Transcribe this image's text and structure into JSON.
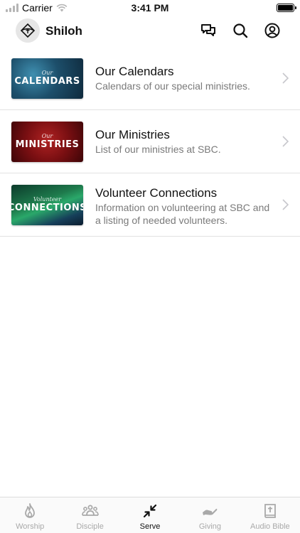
{
  "status_bar": {
    "carrier": "Carrier",
    "time": "3:41 PM"
  },
  "header": {
    "app_name": "Shiloh",
    "icons": [
      "chat-icon",
      "search-icon",
      "profile-icon"
    ]
  },
  "items": [
    {
      "title": "Our Calendars",
      "subtitle": "Calendars of our special ministries.",
      "thumb_script": "Our",
      "thumb_title": "CALENDARS"
    },
    {
      "title": "Our Ministries",
      "subtitle": "List of our ministries at SBC.",
      "thumb_script": "Our",
      "thumb_title": "MINISTRIES"
    },
    {
      "title": "Volunteer Connections",
      "subtitle": "Information on volunteering at SBC and a listing of needed volunteers.",
      "thumb_script": "Volunteer",
      "thumb_title": "CONNECTIONS"
    }
  ],
  "tabs": [
    {
      "label": "Worship",
      "icon": "flame-icon",
      "active": false
    },
    {
      "label": "Disciple",
      "icon": "people-icon",
      "active": false
    },
    {
      "label": "Serve",
      "icon": "arrows-in-icon",
      "active": true
    },
    {
      "label": "Giving",
      "icon": "giving-hand-icon",
      "active": false
    },
    {
      "label": "Audio Bible",
      "icon": "bible-icon",
      "active": false
    }
  ],
  "colors": {
    "active_tab": "#111111",
    "inactive_tab": "#a9a9a9",
    "subtitle": "#7a7a7a",
    "divider": "#e2e2e2"
  }
}
